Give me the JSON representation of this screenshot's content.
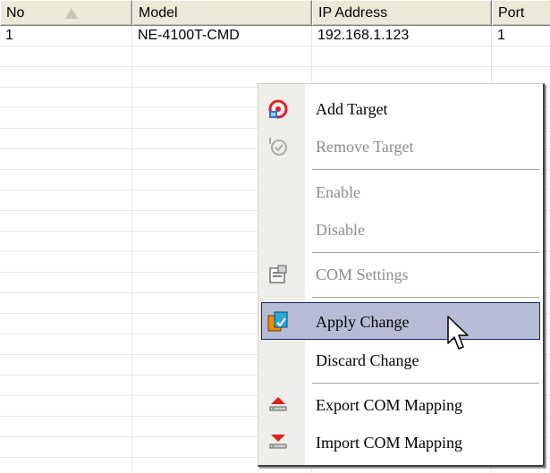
{
  "table": {
    "columns": [
      {
        "label": "No"
      },
      {
        "label": "Model"
      },
      {
        "label": "IP Address"
      },
      {
        "label": "Port"
      }
    ],
    "rows": [
      {
        "no": "1",
        "model": "NE-4100T-CMD",
        "ip": "192.168.1.123",
        "port": "1"
      }
    ]
  },
  "context_menu": {
    "items": [
      {
        "label": "Add Target",
        "enabled": true,
        "icon": "add-target-icon"
      },
      {
        "label": "Remove Target",
        "enabled": false,
        "icon": "remove-target-icon"
      },
      {
        "label": "Enable",
        "enabled": false
      },
      {
        "label": "Disable",
        "enabled": false
      },
      {
        "label": "COM Settings",
        "enabled": false,
        "icon": "com-settings-icon"
      },
      {
        "label": "Apply Change",
        "enabled": true,
        "highlighted": true,
        "icon": "apply-change-icon"
      },
      {
        "label": "Discard Change",
        "enabled": true
      },
      {
        "label": "Export COM Mapping",
        "enabled": true,
        "icon": "export-icon"
      },
      {
        "label": "Import COM Mapping",
        "enabled": true,
        "icon": "import-icon"
      }
    ]
  },
  "colors": {
    "header_bg": "#ece9d8",
    "highlight": "#b7bcd6",
    "disabled_text": "#8c8c8c"
  }
}
